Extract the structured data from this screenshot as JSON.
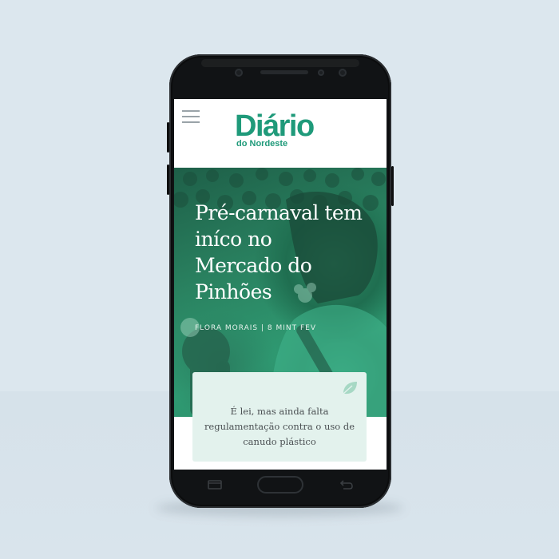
{
  "app": {
    "logo_main": "Diário",
    "logo_sub": "do Nordeste"
  },
  "article": {
    "title": "Pré-carnaval tem iníco no Mercado do Pinhões",
    "byline": "FLORA MORAIS | 8 MINT FEV"
  },
  "card": {
    "text": "É lei, mas ainda falta regulamentação contra o uso de canudo plástico",
    "icon": "leaf-icon"
  },
  "icons": {
    "menu": "hamburger-menu-icon",
    "recent": "recent-apps-icon",
    "home": "home-button",
    "back": "back-icon"
  },
  "colors": {
    "brand": "#1f9a7a",
    "card_bg": "#e3f2ed",
    "hero_tint": "#2a8361"
  }
}
